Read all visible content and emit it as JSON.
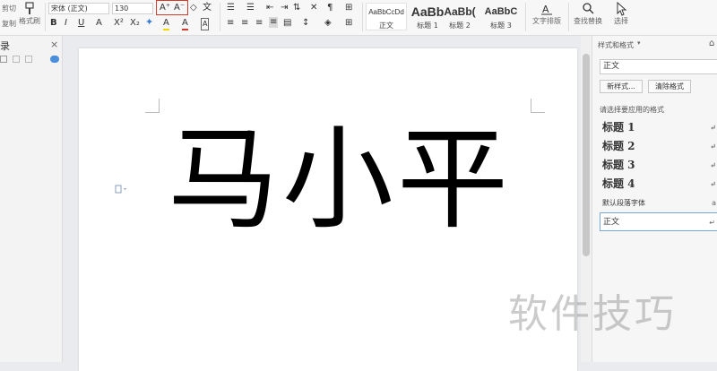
{
  "toolbar": {
    "cut": "剪切",
    "copy": "复制",
    "format_painter": "格式刷",
    "font_name": "宋体 (正文)",
    "font_size": "130",
    "grow_font": "A⁺",
    "shrink_font": "A⁻",
    "clear_format": "◇",
    "pinyin": "文",
    "bold": "B",
    "italic": "I",
    "underline": "U",
    "font_color_a": "A",
    "superscript": "X²",
    "subscript": "X₂",
    "highlight": "A",
    "text_color": "A",
    "char_border": "A",
    "text_layout": "文字排版",
    "find_replace": "查找替换",
    "select": "选择"
  },
  "styles_gallery": [
    {
      "sample": "AaBbCcDd",
      "label": "正文"
    },
    {
      "sample": "AaBb",
      "label": "标题 1"
    },
    {
      "sample": "AaBb(",
      "label": "标题 2"
    },
    {
      "sample": "AaBbC",
      "label": "标题 3"
    }
  ],
  "left_panel": {
    "title": "录",
    "close": "×"
  },
  "document": {
    "content": "马小平"
  },
  "right_panel": {
    "title": "样式和格式",
    "current_style": "正文",
    "new_style_button": "新样式...",
    "clear_format_button": "清除格式",
    "apply_label": "请选择要应用的格式",
    "styles": [
      {
        "name": "标题  1",
        "kind": "heading"
      },
      {
        "name": "标题  2",
        "kind": "heading"
      },
      {
        "name": "标题  3",
        "kind": "heading"
      },
      {
        "name": "标题  4",
        "kind": "heading"
      },
      {
        "name": "默认段落字体",
        "kind": "plain"
      },
      {
        "name": "正文",
        "kind": "selected"
      }
    ]
  },
  "watermark": "软件技巧"
}
